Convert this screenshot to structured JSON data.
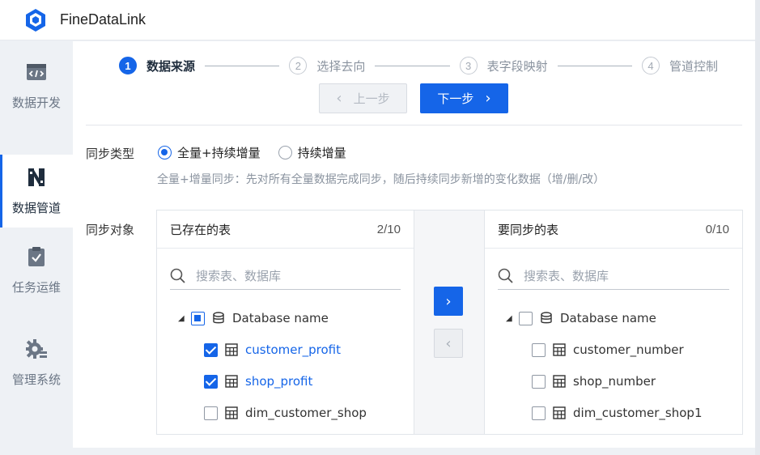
{
  "app": {
    "brand": "FineDataLink"
  },
  "sidebar": {
    "items": [
      {
        "label": "数据开发",
        "icon": "code-icon"
      },
      {
        "label": "数据管道",
        "icon": "pipeline-icon",
        "active": true
      },
      {
        "label": "任务运维",
        "icon": "task-check-icon"
      },
      {
        "label": "管理系统",
        "icon": "gear-icon"
      }
    ]
  },
  "steps": [
    {
      "num": "1",
      "label": "数据来源",
      "active": true
    },
    {
      "num": "2",
      "label": "选择去向"
    },
    {
      "num": "3",
      "label": "表字段映射"
    },
    {
      "num": "4",
      "label": "管道控制"
    }
  ],
  "nav": {
    "prev_label": "上一步",
    "next_label": "下一步"
  },
  "sync_type": {
    "label": "同步类型",
    "options": [
      "全量+持续增量",
      "持续增量"
    ],
    "selected": "全量+持续增量",
    "hint": "全量+增量同步：先对所有全量数据完成同步，随后持续同步新增的变化数据（增/删/改）"
  },
  "sync_object": {
    "label": "同步对象",
    "left": {
      "title": "已存在的表",
      "count": "2/10",
      "search_placeholder": "搜索表、数据库",
      "db_name": "Database name",
      "tables": [
        {
          "name": "customer_profit",
          "checked": true
        },
        {
          "name": "shop_profit",
          "checked": true
        },
        {
          "name": "dim_customer_shop",
          "checked": false
        }
      ]
    },
    "right": {
      "title": "要同步的表",
      "count": "0/10",
      "search_placeholder": "搜索表、数据库",
      "db_name": "Database name",
      "tables": [
        {
          "name": "customer_number",
          "checked": false
        },
        {
          "name": "shop_number",
          "checked": false
        },
        {
          "name": "dim_customer_shop1",
          "checked": false
        }
      ]
    }
  },
  "colors": {
    "accent": "#1565e8"
  }
}
